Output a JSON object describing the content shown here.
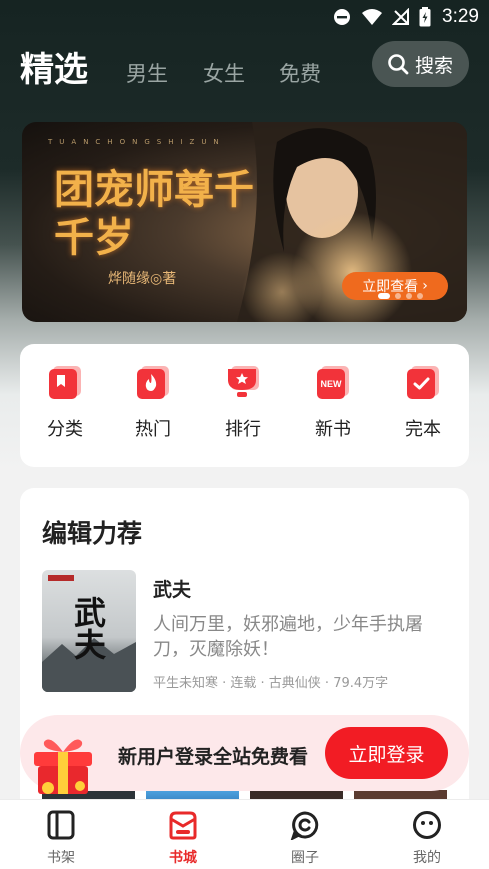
{
  "status_bar": {
    "time": "3:29"
  },
  "header": {
    "tabs": [
      {
        "label": "精选",
        "active": true
      },
      {
        "label": "男生"
      },
      {
        "label": "女生"
      },
      {
        "label": "免费"
      }
    ],
    "search_label": "搜索"
  },
  "banner": {
    "spelled_title": "TUANCHONGSHIZUN",
    "title": "团宠师尊千千岁",
    "author": "烨随缘◎著",
    "button_label": "立即查看",
    "page_count": 4,
    "active_page": 1
  },
  "categories": [
    {
      "label": "分类",
      "icon": "bookmark-icon"
    },
    {
      "label": "热门",
      "icon": "flame-icon"
    },
    {
      "label": "排行",
      "icon": "trophy-icon"
    },
    {
      "label": "新书",
      "icon": "new-badge-icon",
      "icon_text": "NEW"
    },
    {
      "label": "完本",
      "icon": "checkmark-icon"
    }
  ],
  "editor_pick": {
    "section_title": "编辑力荐",
    "book": {
      "title": "武夫",
      "cover_title": "武夫",
      "description": "人间万里，妖邪遍地，少年手执屠刀，灭魔除妖！",
      "meta": "平生未知寒 · 连载 · 古典仙侠 · 79.4万字"
    }
  },
  "promo": {
    "text": "新用户登录全站免费看",
    "button_label": "立即登录"
  },
  "bottom_nav": {
    "items": [
      {
        "label": "书架",
        "icon": "bookshelf-icon"
      },
      {
        "label": "书城",
        "icon": "bookstore-icon",
        "active": true
      },
      {
        "label": "圈子",
        "icon": "community-icon"
      },
      {
        "label": "我的",
        "icon": "profile-icon"
      }
    ]
  },
  "colors": {
    "accent_red": "#f21c24",
    "banner_button": "#ef6a1e",
    "header_bg": "#1d2b29"
  }
}
